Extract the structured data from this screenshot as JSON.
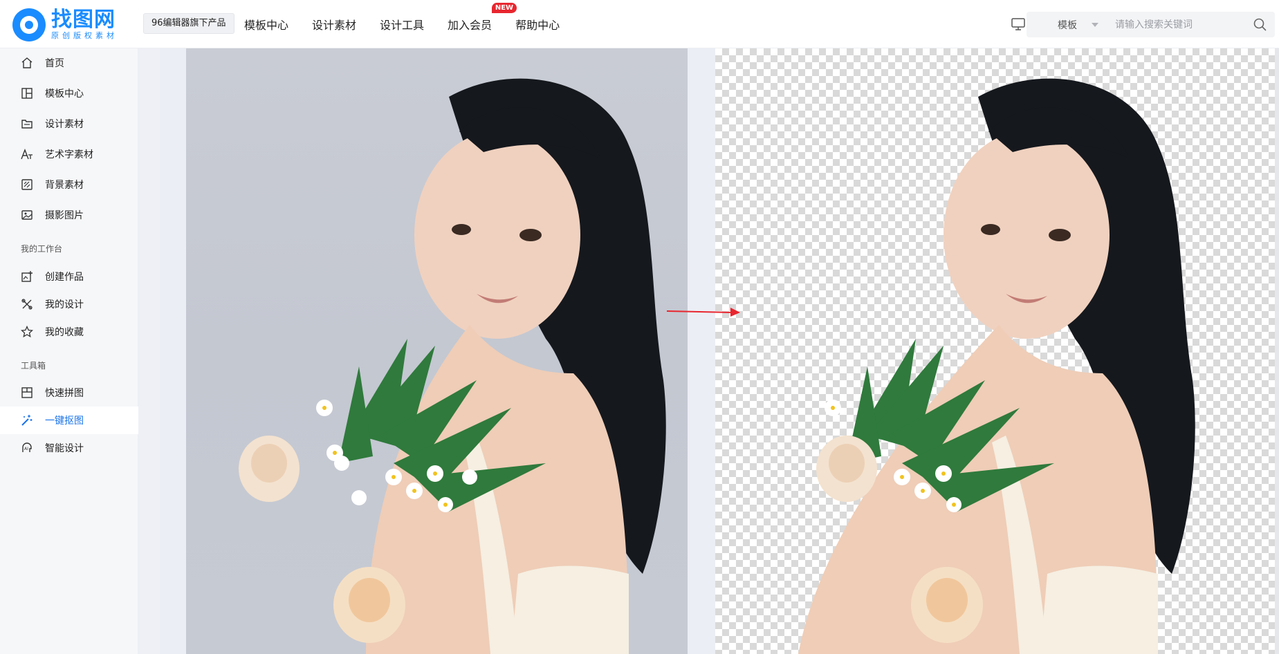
{
  "header": {
    "logo_title": "找图网",
    "logo_sub": "原创版权素材",
    "product_tag": "96编辑器旗下产品",
    "nav": [
      {
        "label": "模板中心"
      },
      {
        "label": "设计素材"
      },
      {
        "label": "设计工具"
      },
      {
        "label": "加入会员",
        "badge": "NEW"
      },
      {
        "label": "帮助中心"
      }
    ],
    "search": {
      "type": "模板",
      "placeholder": "请输入搜索关键词",
      "value": ""
    }
  },
  "sidebar": {
    "items": [
      {
        "label": "首页",
        "icon": "home-icon"
      },
      {
        "label": "模板中心",
        "icon": "template-icon"
      },
      {
        "label": "设计素材",
        "icon": "material-icon"
      },
      {
        "label": "艺术字素材",
        "icon": "art-font-icon"
      },
      {
        "label": "背景素材",
        "icon": "background-icon"
      },
      {
        "label": "摄影图片",
        "icon": "photo-icon"
      }
    ],
    "workspace_title": "我的工作台",
    "workspace": [
      {
        "label": "创建作品",
        "icon": "create-icon"
      },
      {
        "label": "我的设计",
        "icon": "design-icon"
      },
      {
        "label": "我的收藏",
        "icon": "star-icon"
      }
    ],
    "toolbox_title": "工具箱",
    "toolbox": [
      {
        "label": "快速拼图",
        "icon": "collage-icon"
      },
      {
        "label": "一键抠图",
        "icon": "magic-wand-icon",
        "active": true
      },
      {
        "label": "智能设计",
        "icon": "ai-design-icon"
      }
    ]
  },
  "colors": {
    "brand": "#1a8cff",
    "active": "#1a73e8",
    "badge": "#e8262f",
    "arrow": "#e8262f"
  }
}
